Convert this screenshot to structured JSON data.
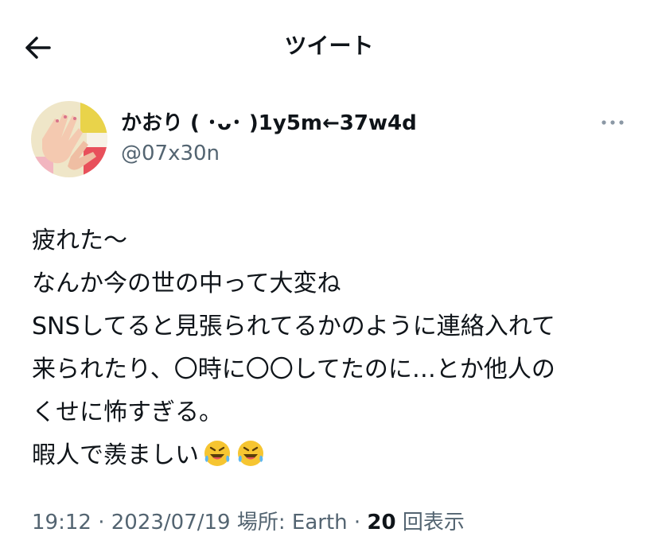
{
  "header": {
    "back_icon": "arrow-left-icon",
    "title": "ツイート"
  },
  "author": {
    "display_name": "かおり ( ･ᴗ･ )1y5m←37w4d",
    "handle": "@07x30n",
    "more_icon": "more-horizontal-icon"
  },
  "tweet": {
    "lines": [
      "疲れた〜",
      "なんか今の世の中って大変ね",
      "SNSしてると見張られてるかのように連絡入れて",
      "来られたり、〇時に〇〇してたのに…とか他人の",
      "くせに怖すぎる。",
      "暇人で羨ましい"
    ],
    "emoji": [
      "🤣",
      "🤣"
    ]
  },
  "meta": {
    "time": "19:12",
    "sep1": " · ",
    "date": "2023/07/19",
    "location_label": " 場所: ",
    "location": "Earth",
    "sep2": " · ",
    "views_count": "20",
    "views_label": " 回表示"
  },
  "colors": {
    "text_primary": "#0f1419",
    "text_secondary": "#536471"
  }
}
